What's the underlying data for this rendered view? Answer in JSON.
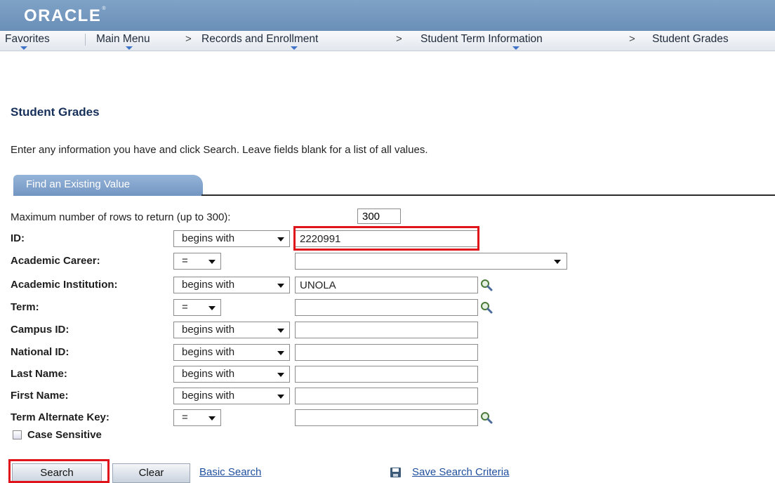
{
  "header": {
    "logo_text": "ORACLE",
    "logo_tm": "®",
    "brand_color": "#6a8fb8"
  },
  "nav": {
    "items": [
      {
        "label": "Favorites"
      },
      {
        "label": "Main Menu"
      },
      {
        "label": "Records and Enrollment"
      },
      {
        "label": "Student Term Information"
      },
      {
        "label": "Student Grades"
      }
    ],
    "separator": ">"
  },
  "page": {
    "title": "Student Grades",
    "instructions": "Enter any information you have and click Search. Leave fields blank for a list of all values."
  },
  "tab": {
    "label": "Find an Existing Value"
  },
  "form": {
    "max_rows_label": "Maximum number of rows to return (up to 300):",
    "max_rows_value": "300",
    "fields": [
      {
        "label": "ID:",
        "operator": "begins with",
        "value": "2220991",
        "lookup": false
      },
      {
        "label": "Academic Career:",
        "operator": "=",
        "value": "",
        "lookup": false
      },
      {
        "label": "Academic Institution:",
        "operator": "begins with",
        "value": "UNOLA",
        "lookup": true
      },
      {
        "label": "Term:",
        "operator": "=",
        "value": "",
        "lookup": true
      },
      {
        "label": "Campus ID:",
        "operator": "begins with",
        "value": "",
        "lookup": false
      },
      {
        "label": "National ID:",
        "operator": "begins with",
        "value": "",
        "lookup": false
      },
      {
        "label": "Last Name:",
        "operator": "begins with",
        "value": "",
        "lookup": false
      },
      {
        "label": "First Name:",
        "operator": "begins with",
        "value": "",
        "lookup": false
      },
      {
        "label": "Term Alternate Key:",
        "operator": "=",
        "value": "",
        "lookup": true
      }
    ],
    "case_sensitive_label": "Case Sensitive",
    "case_sensitive_checked": false
  },
  "actions": {
    "search_label": "Search",
    "clear_label": "Clear",
    "basic_search_label": "Basic Search",
    "save_criteria_label": "Save Search Criteria"
  },
  "colors": {
    "highlight": "#e0141b",
    "link": "#1f4f9e",
    "title": "#17305a"
  },
  "icons": {
    "lookup": "magnifier-icon",
    "save": "floppy-disk-icon",
    "dropdown": "chevron-down-icon"
  }
}
